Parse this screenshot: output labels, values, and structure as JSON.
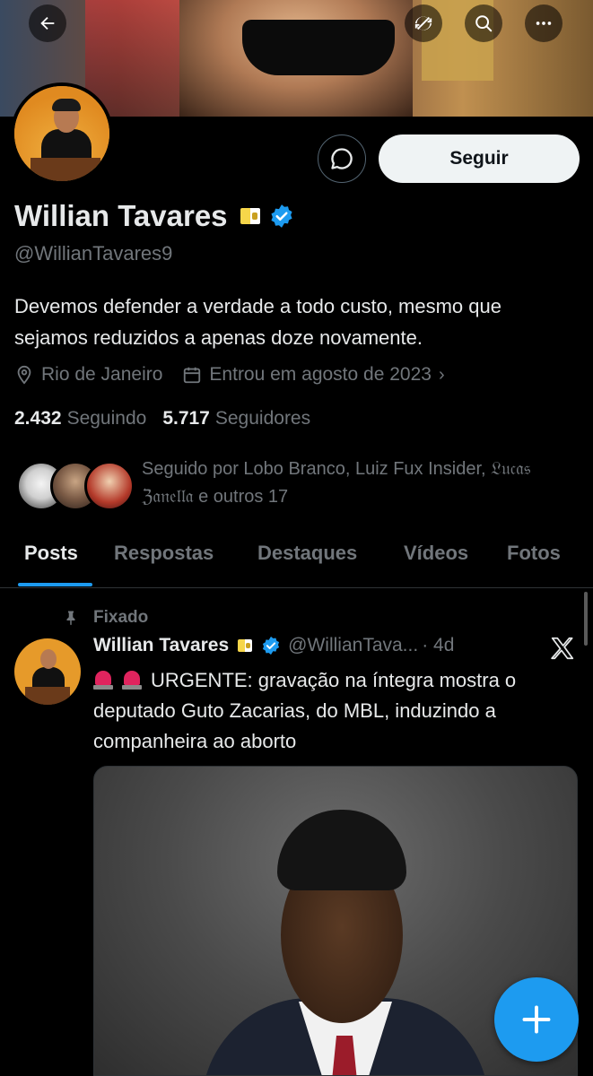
{
  "profile": {
    "name": "Willian Tavares",
    "handle": "@WillianTavares9",
    "bio": "Devemos defender a verdade a todo custo, mesmo que sejamos reduzidos a apenas doze novamente.",
    "location": "Rio de Janeiro",
    "joined": "Entrou em agosto de 2023",
    "following_count": "2.432",
    "following_label": "Seguindo",
    "followers_count": "5.717",
    "followers_label": "Seguidores",
    "followed_by": "Seguido por Lobo Branco, Luiz Fux Insider, 𝔏𝔲𝔠𝔞𝔰 ℨ𝔞𝔫𝔢𝔩𝔩𝔞 e outros 17"
  },
  "actions": {
    "follow_label": "Seguir"
  },
  "tabs": [
    {
      "label": "Posts"
    },
    {
      "label": "Respostas"
    },
    {
      "label": "Destaques"
    },
    {
      "label": "Vídeos"
    },
    {
      "label": "Fotos"
    }
  ],
  "pinned_post": {
    "pinned_label": "Fixado",
    "author": "Willian Tavares",
    "handle": "@WillianTava...",
    "time": "· 4d",
    "text": "URGENTE: gravação na íntegra mostra o deputado Guto Zacarias, do MBL, induzindo a companheira ao aborto"
  },
  "icons": {
    "back": "arrow-left-icon",
    "refresh": "refresh-icon",
    "search": "search-icon",
    "more": "more-icon",
    "message": "message-icon",
    "location": "location-icon",
    "calendar": "calendar-icon",
    "verified": "verified-badge-icon",
    "flag": "vatican-flag-icon",
    "pin": "pin-icon",
    "x": "x-logo-icon",
    "compose": "plus-icon"
  },
  "colors": {
    "accent": "#1d9bf0",
    "background": "#000000",
    "muted": "#71767b"
  }
}
